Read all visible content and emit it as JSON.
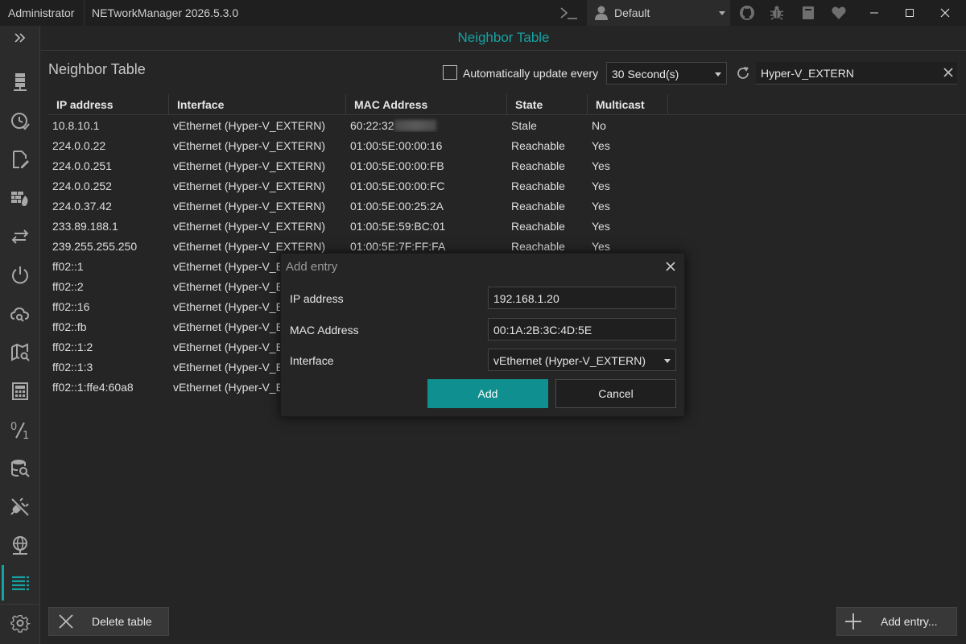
{
  "titlebar": {
    "user": "Administrator",
    "app_title": "NETworkManager 2026.5.3.0",
    "profile": "Default"
  },
  "header": {
    "title": "Neighbor Table"
  },
  "view": {
    "title": "Neighbor Table",
    "auto_update_label": "Automatically update every",
    "auto_update_checked": false,
    "interval": "30 Second(s)",
    "search_value": "Hyper-V_EXTERN"
  },
  "table": {
    "columns": [
      "IP address",
      "Interface",
      "MAC Address",
      "State",
      "Multicast"
    ],
    "rows": [
      {
        "ip": "10.8.10.1",
        "iface": "vEthernet (Hyper-V_EXTERN)",
        "mac": "60:22:32",
        "state": "Stale",
        "multicast": "No"
      },
      {
        "ip": "224.0.0.22",
        "iface": "vEthernet (Hyper-V_EXTERN)",
        "mac": "01:00:5E:00:00:16",
        "state": "Reachable",
        "multicast": "Yes"
      },
      {
        "ip": "224.0.0.251",
        "iface": "vEthernet (Hyper-V_EXTERN)",
        "mac": "01:00:5E:00:00:FB",
        "state": "Reachable",
        "multicast": "Yes"
      },
      {
        "ip": "224.0.0.252",
        "iface": "vEthernet (Hyper-V_EXTERN)",
        "mac": "01:00:5E:00:00:FC",
        "state": "Reachable",
        "multicast": "Yes"
      },
      {
        "ip": "224.0.37.42",
        "iface": "vEthernet (Hyper-V_EXTERN)",
        "mac": "01:00:5E:00:25:2A",
        "state": "Reachable",
        "multicast": "Yes"
      },
      {
        "ip": "233.89.188.1",
        "iface": "vEthernet (Hyper-V_EXTERN)",
        "mac": "01:00:5E:59:BC:01",
        "state": "Reachable",
        "multicast": "Yes"
      },
      {
        "ip": "239.255.255.250",
        "iface": "vEthernet (Hyper-V_EXTERN)",
        "mac": "01:00:5E:7F:FF:FA",
        "state": "Reachable",
        "multicast": "Yes"
      },
      {
        "ip": "ff02::1",
        "iface": "vEthernet (Hyper-V_EX",
        "mac": "",
        "state": "",
        "multicast": ""
      },
      {
        "ip": "ff02::2",
        "iface": "vEthernet (Hyper-V_EX",
        "mac": "",
        "state": "",
        "multicast": ""
      },
      {
        "ip": "ff02::16",
        "iface": "vEthernet (Hyper-V_EX",
        "mac": "",
        "state": "",
        "multicast": ""
      },
      {
        "ip": "ff02::fb",
        "iface": "vEthernet (Hyper-V_EX",
        "mac": "",
        "state": "",
        "multicast": ""
      },
      {
        "ip": "ff02::1:2",
        "iface": "vEthernet (Hyper-V_EX",
        "mac": "",
        "state": "",
        "multicast": ""
      },
      {
        "ip": "ff02::1:3",
        "iface": "vEthernet (Hyper-V_EX",
        "mac": "",
        "state": "",
        "multicast": ""
      },
      {
        "ip": "ff02::1:ffe4:60a8",
        "iface": "vEthernet (Hyper-V_EX",
        "mac": "",
        "state": "",
        "multicast": ""
      }
    ]
  },
  "footer": {
    "delete_label": "Delete table",
    "add_entry_label": "Add entry..."
  },
  "dialog": {
    "title": "Add entry",
    "ip_label": "IP address",
    "ip_value": "192.168.1.20",
    "mac_label": "MAC Address",
    "mac_value": "00:1A:2B:3C:4D:5E",
    "iface_label": "Interface",
    "iface_value": "vEthernet (Hyper-V_EXTERN)",
    "add_label": "Add",
    "cancel_label": "Cancel"
  },
  "colors": {
    "accent": "#16a2a2",
    "add_button": "#0f8f8f",
    "background": "#252525"
  },
  "nav_icons": [
    "server-icon",
    "history-icon",
    "edit-document-icon",
    "firewall-icon",
    "transfer-icon",
    "power-icon",
    "cloud-search-icon",
    "map-search-icon",
    "calculator-icon",
    "percent-icon",
    "database-search-icon",
    "plug-off-icon",
    "globe-network-icon",
    "list-icon",
    "settings-icon"
  ]
}
